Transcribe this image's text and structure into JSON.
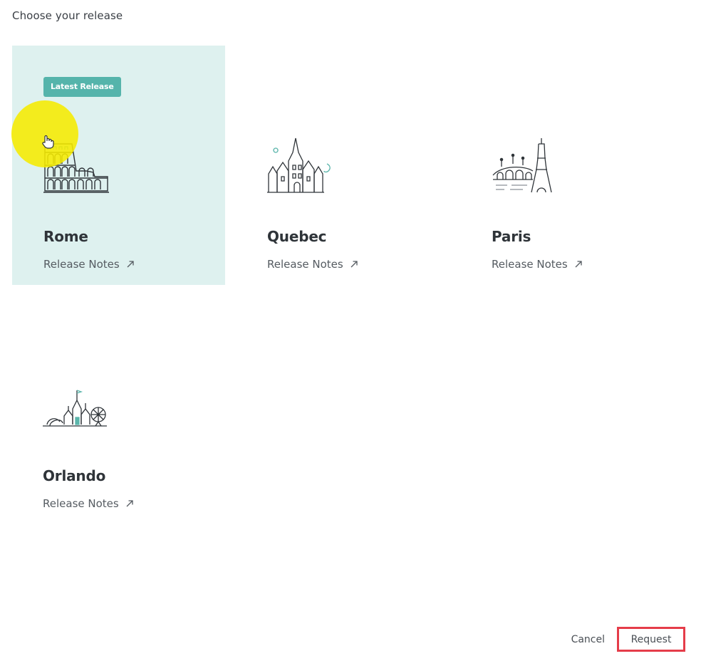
{
  "page": {
    "title": "Choose your release"
  },
  "releases": [
    {
      "name": "Rome",
      "link_label": "Release Notes",
      "badge": "Latest Release",
      "selected": true,
      "icon": "colosseum-icon"
    },
    {
      "name": "Quebec",
      "link_label": "Release Notes",
      "icon": "chateau-icon"
    },
    {
      "name": "Paris",
      "link_label": "Release Notes",
      "icon": "eiffel-tower-icon"
    },
    {
      "name": "Orlando",
      "link_label": "Release Notes",
      "icon": "theme-park-castle-icon"
    }
  ],
  "footer": {
    "cancel_label": "Cancel",
    "request_label": "Request"
  },
  "colors": {
    "selected_bg": "#def1ef",
    "badge_bg": "#55b4ab",
    "accent_teal": "#5bb5ab",
    "request_border": "#e53c49",
    "cursor_highlight": "#f6ea00"
  }
}
